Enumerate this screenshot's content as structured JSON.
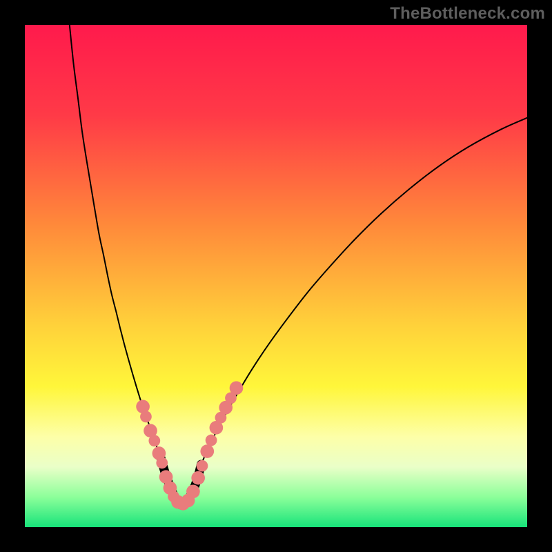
{
  "watermark": "TheBottleneck.com",
  "chart_data": {
    "type": "line",
    "title": "",
    "xlabel": "",
    "ylabel": "",
    "xlim": [
      0,
      100
    ],
    "ylim": [
      0,
      100
    ],
    "gradient_stops": [
      {
        "offset": 0,
        "color": "#ff1a4c"
      },
      {
        "offset": 18,
        "color": "#ff3a47"
      },
      {
        "offset": 40,
        "color": "#ff8a3a"
      },
      {
        "offset": 60,
        "color": "#ffd23a"
      },
      {
        "offset": 72,
        "color": "#fff63a"
      },
      {
        "offset": 82,
        "color": "#fdffa8"
      },
      {
        "offset": 88,
        "color": "#eaffc8"
      },
      {
        "offset": 94,
        "color": "#8cff9a"
      },
      {
        "offset": 100,
        "color": "#17e37a"
      }
    ],
    "series": [
      {
        "name": "left-curve",
        "x": [
          8.9,
          9.7,
          10.6,
          11.4,
          12.3,
          13.2,
          14.0,
          14.8,
          15.7,
          16.5,
          17.3,
          18.2,
          19.0,
          19.8,
          20.6,
          21.4,
          22.2,
          23.0,
          23.8,
          24.7,
          25.5,
          26.3,
          27.1
        ],
        "y": [
          100,
          92.2,
          85.2,
          78.8,
          73.0,
          67.6,
          62.8,
          58.2,
          54.0,
          50.0,
          46.3,
          42.8,
          39.5,
          36.4,
          33.5,
          30.7,
          28.0,
          25.4,
          22.9,
          20.5,
          18.2,
          15.9,
          13.7
        ]
      },
      {
        "name": "right-curve",
        "x": [
          35.1,
          37.1,
          39.5,
          42.2,
          45.2,
          48.6,
          52.4,
          56.5,
          61.0,
          65.8,
          70.9,
          76.4,
          82.2,
          88.3,
          94.8,
          100
        ],
        "y": [
          12.5,
          17.0,
          21.6,
          26.4,
          31.4,
          36.5,
          41.7,
          47.0,
          52.2,
          57.4,
          62.4,
          67.2,
          71.7,
          75.7,
          79.2,
          81.5
        ]
      },
      {
        "name": "floor-curve",
        "x": [
          27.1,
          27.6,
          28.1,
          28.6,
          29.1,
          29.6,
          30.1,
          30.6,
          31.1,
          31.6,
          32.1,
          32.6,
          33.1,
          33.6,
          34.1,
          34.6,
          35.1
        ],
        "y": [
          13.7,
          11.9,
          10.3,
          8.9,
          7.6,
          6.5,
          5.6,
          4.9,
          4.4,
          4.4,
          4.9,
          5.6,
          6.5,
          7.6,
          8.9,
          10.5,
          12.5
        ]
      }
    ],
    "highlight_dots": [
      {
        "x": 23.5,
        "y": 24.0,
        "r": 1.35
      },
      {
        "x": 24.1,
        "y": 22.0,
        "r": 1.15
      },
      {
        "x": 25.0,
        "y": 19.2,
        "r": 1.35
      },
      {
        "x": 25.8,
        "y": 17.2,
        "r": 1.15
      },
      {
        "x": 26.7,
        "y": 14.7,
        "r": 1.35
      },
      {
        "x": 27.3,
        "y": 12.8,
        "r": 1.15
      },
      {
        "x": 28.1,
        "y": 10.0,
        "r": 1.35
      },
      {
        "x": 28.9,
        "y": 7.8,
        "r": 1.35
      },
      {
        "x": 29.6,
        "y": 6.1,
        "r": 1.15
      },
      {
        "x": 30.5,
        "y": 5.0,
        "r": 1.35
      },
      {
        "x": 31.5,
        "y": 4.7,
        "r": 1.35
      },
      {
        "x": 32.5,
        "y": 5.3,
        "r": 1.35
      },
      {
        "x": 33.5,
        "y": 7.1,
        "r": 1.35
      },
      {
        "x": 34.5,
        "y": 9.8,
        "r": 1.35
      },
      {
        "x": 35.3,
        "y": 12.2,
        "r": 1.15
      },
      {
        "x": 36.3,
        "y": 15.1,
        "r": 1.35
      },
      {
        "x": 37.1,
        "y": 17.3,
        "r": 1.15
      },
      {
        "x": 38.1,
        "y": 19.8,
        "r": 1.35
      },
      {
        "x": 39.0,
        "y": 21.8,
        "r": 1.15
      },
      {
        "x": 40.0,
        "y": 23.8,
        "r": 1.35
      },
      {
        "x": 41.0,
        "y": 25.7,
        "r": 1.15
      },
      {
        "x": 42.1,
        "y": 27.7,
        "r": 1.35
      }
    ],
    "highlight_dot_color": "#e97c7c",
    "curve_color": "#000000",
    "curve_width": 2.0,
    "floor_width": 13.0
  }
}
